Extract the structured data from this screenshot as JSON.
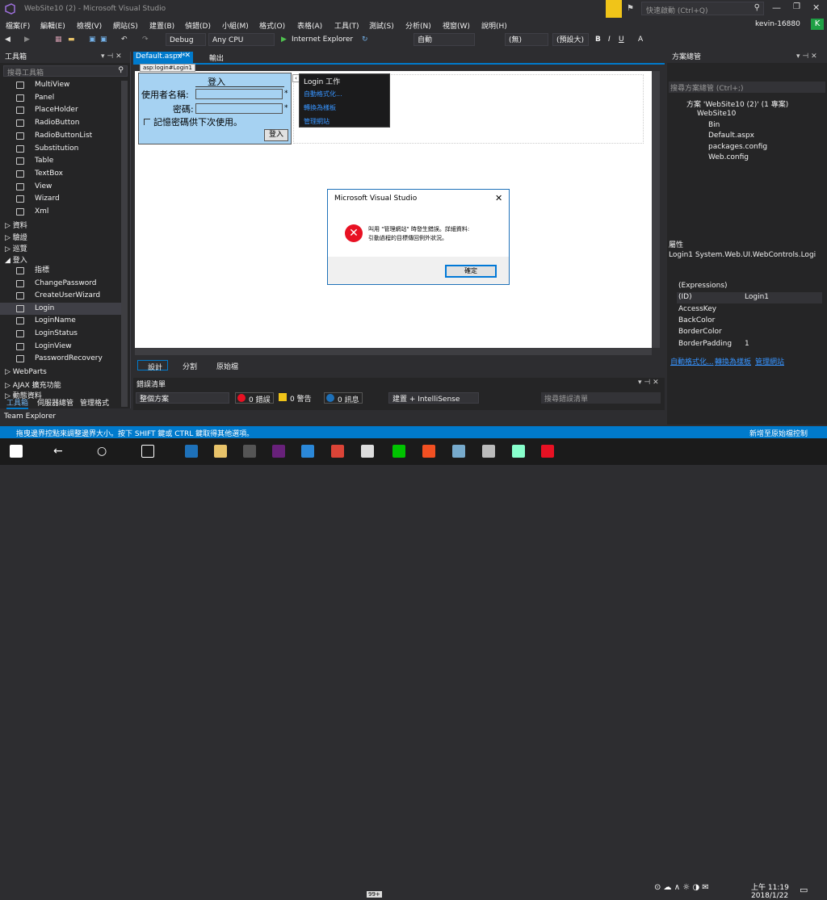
{
  "titlebar": {
    "title": "WebSite10 (2) - Microsoft Visual Studio",
    "quick_launch": "快速啟動 (Ctrl+Q)",
    "user": "kevin-16880",
    "user_initial": "K"
  },
  "menu": [
    "檔案(F)",
    "編輯(E)",
    "檢視(V)",
    "網站(S)",
    "建置(B)",
    "偵錯(D)",
    "小組(M)",
    "格式(O)",
    "表格(A)",
    "工具(T)",
    "測試(S)",
    "分析(N)",
    "視窗(W)",
    "說明(H)"
  ],
  "toolbar": {
    "config": "Debug",
    "platform": "Any CPU",
    "browser": "Internet Explorer",
    "mode": "自動",
    "style_target": "(無)",
    "style_pick": "(預設大)"
  },
  "toolbox": {
    "title": "工具箱",
    "search_placeholder": "搜尋工具箱",
    "items": [
      "MultiView",
      "Panel",
      "PlaceHolder",
      "RadioButton",
      "RadioButtonList",
      "Substitution",
      "Table",
      "TextBox",
      "View",
      "Wizard",
      "Xml"
    ],
    "groups_mid": [
      "資料",
      "驗證",
      "巡覽"
    ],
    "login_group": "登入",
    "login_items": [
      "指標",
      "ChangePassword",
      "CreateUserWizard",
      "Login",
      "LoginName",
      "LoginStatus",
      "LoginView",
      "PasswordRecovery"
    ],
    "groups_bottom": [
      "WebParts",
      "AJAX 擴充功能",
      "動態資料"
    ],
    "bottom_tabs": [
      "工具箱",
      "伺服器總管",
      "管理格式"
    ],
    "team_explorer": "Team Explorer"
  },
  "editor": {
    "tab_active": "Default.aspx*",
    "tab_other": "輸出",
    "tag": "asp:login#Login1",
    "login_title": "登入",
    "user_label": "使用者名稱:",
    "pass_label": "密碼:",
    "remember": "記憶密碼供下次使用。",
    "login_button": "登入",
    "required_mark": "*",
    "tasks_title": "Login 工作",
    "tasks": [
      "自動格式化...",
      "轉換為樣板",
      "管理網站"
    ],
    "view_tabs": [
      "設計",
      "分割",
      "原始檔"
    ]
  },
  "dialog": {
    "title": "Microsoft Visual Studio",
    "line1": "叫用 \"管理網站\" 時發生錯誤。詳細資料:",
    "line2": "引動過程的目標傳回例外狀況。",
    "ok": "確定"
  },
  "errors": {
    "title": "錯誤清單",
    "scope": "整個方案",
    "errors": "0 錯誤",
    "warnings": "0 警告",
    "messages": "0 訊息",
    "build": "建置 + IntelliSense",
    "search": "搜尋錯誤清單"
  },
  "solution": {
    "title": "方案總管",
    "search": "搜尋方案總管 (Ctrl+;)",
    "root": "方案 'WebSite10 (2)' (1 專案)",
    "project": "WebSite10",
    "items": [
      "Bin",
      "Default.aspx",
      "packages.config",
      "Web.config"
    ]
  },
  "properties": {
    "title": "屬性",
    "object": "Login1  System.Web.UI.WebControls.Logi",
    "rows": [
      {
        "name": "(Expressions)",
        "value": ""
      },
      {
        "name": "(ID)",
        "value": "Login1"
      },
      {
        "name": "AccessKey",
        "value": ""
      },
      {
        "name": "BackColor",
        "value": ""
      },
      {
        "name": "BorderColor",
        "value": ""
      },
      {
        "name": "BorderPadding",
        "value": "1"
      }
    ],
    "links": [
      "自動格式化...",
      "轉換為樣板",
      "管理網站"
    ]
  },
  "status": {
    "text": "拖曳邊界控點來調整邊界大小。按下 SHIFT 鍵或 CTRL 鍵取得其他選項。",
    "right": "新增至原始檔控制"
  },
  "taskbar": {
    "time": "上午 11:19",
    "date": "2018/1/22",
    "badge": "99+"
  },
  "colors": {
    "accent": "#007acc",
    "login_bg": "#a6d2f2",
    "error_red": "#e81123"
  }
}
